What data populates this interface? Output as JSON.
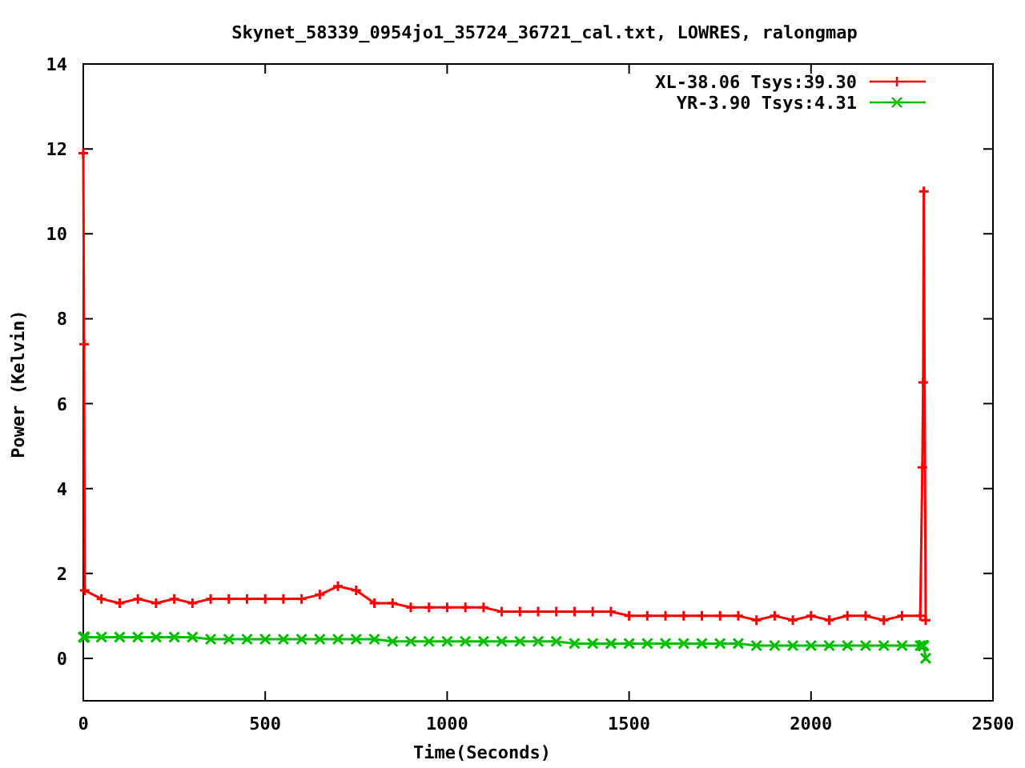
{
  "chart_data": {
    "type": "line",
    "title": "Skynet_58339_0954jo1_35724_36721_cal.txt, LOWRES, ralongmap",
    "xlabel": "Time(Seconds)",
    "ylabel": "Power (Kelvin)",
    "xlim": [
      0,
      2500
    ],
    "ylim": [
      -1,
      14
    ],
    "xticks": [
      0,
      500,
      1000,
      1500,
      2000,
      2500
    ],
    "yticks": [
      0,
      2,
      4,
      6,
      8,
      10,
      12,
      14
    ],
    "legend": true,
    "x": [
      0,
      2,
      4,
      50,
      100,
      150,
      200,
      250,
      300,
      350,
      400,
      450,
      500,
      550,
      600,
      650,
      700,
      750,
      800,
      850,
      900,
      950,
      1000,
      1050,
      1100,
      1150,
      1200,
      1250,
      1300,
      1350,
      1400,
      1450,
      1500,
      1550,
      1600,
      1650,
      1700,
      1750,
      1800,
      1850,
      1900,
      1950,
      2000,
      2050,
      2100,
      2150,
      2200,
      2250,
      2300,
      2306,
      2308,
      2310,
      2315
    ],
    "series": [
      {
        "name": "XL-38.06 Tsys:39.30",
        "color": "#ff0000",
        "marker": "plus",
        "values": [
          11.9,
          7.4,
          1.6,
          1.4,
          1.3,
          1.4,
          1.3,
          1.4,
          1.3,
          1.4,
          1.4,
          1.4,
          1.4,
          1.4,
          1.4,
          1.5,
          1.7,
          1.6,
          1.3,
          1.3,
          1.2,
          1.2,
          1.2,
          1.2,
          1.2,
          1.1,
          1.1,
          1.1,
          1.1,
          1.1,
          1.1,
          1.1,
          1.0,
          1.0,
          1.0,
          1.0,
          1.0,
          1.0,
          1.0,
          0.9,
          1.0,
          0.9,
          1.0,
          0.9,
          1.0,
          1.0,
          0.9,
          1.0,
          1.0,
          4.5,
          6.5,
          11.0,
          0.9
        ]
      },
      {
        "name": "YR-3.90 Tsys:4.31",
        "color": "#00c000",
        "marker": "cross",
        "values": [
          0.5,
          0.5,
          0.5,
          0.5,
          0.5,
          0.5,
          0.5,
          0.5,
          0.5,
          0.45,
          0.45,
          0.45,
          0.45,
          0.45,
          0.45,
          0.45,
          0.45,
          0.45,
          0.45,
          0.4,
          0.4,
          0.4,
          0.4,
          0.4,
          0.4,
          0.4,
          0.4,
          0.4,
          0.4,
          0.35,
          0.35,
          0.35,
          0.35,
          0.35,
          0.35,
          0.35,
          0.35,
          0.35,
          0.35,
          0.3,
          0.3,
          0.3,
          0.3,
          0.3,
          0.3,
          0.3,
          0.3,
          0.3,
          0.3,
          0.3,
          0.3,
          0.3,
          0.0
        ]
      }
    ]
  }
}
